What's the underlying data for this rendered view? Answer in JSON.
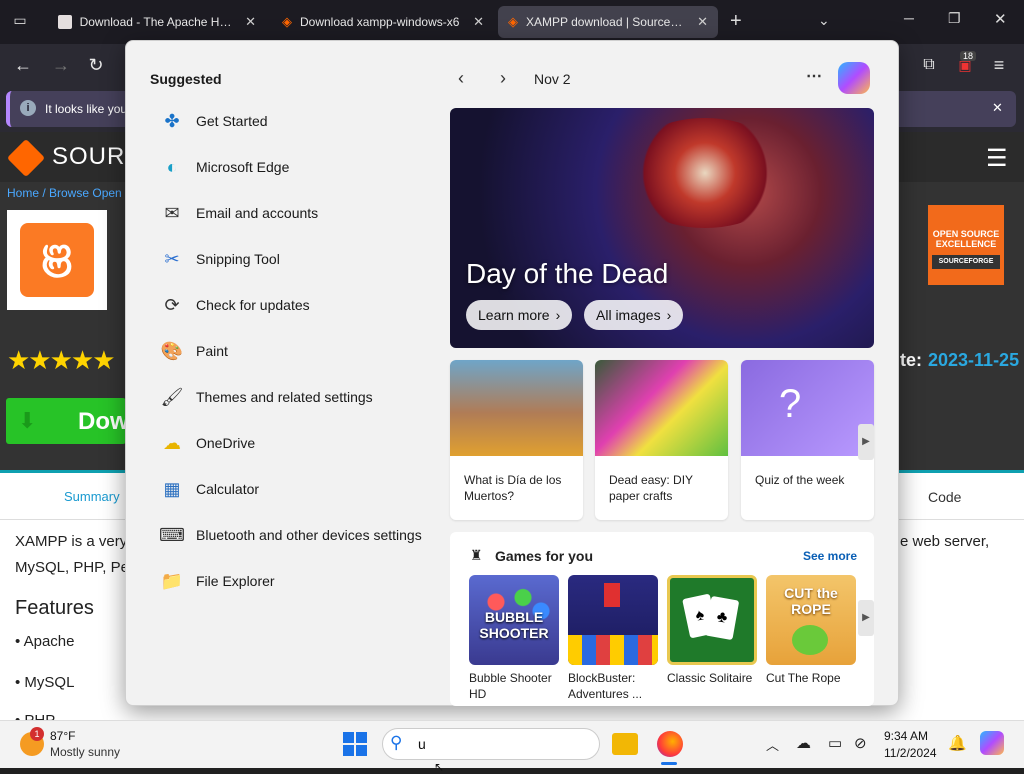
{
  "browser": {
    "tabs": [
      {
        "title": "Download - The Apache HTTP",
        "icon": "page-icon"
      },
      {
        "title": "Download xampp-windows-x6",
        "icon": "sourceforge-icon"
      },
      {
        "title": "XAMPP download | SourceForg",
        "icon": "sourceforge-icon",
        "active": true
      }
    ],
    "badge_count": "18",
    "notice_text": "It looks like you"
  },
  "page": {
    "brand": "SOURC",
    "breadcrumb": "Home / Browse Open S",
    "rating_stars": "★★★★★",
    "date_label": "te:",
    "date_value": "2023-11-25",
    "download_label": "Dow",
    "badge_line1": "OPEN SOURCE",
    "badge_line2": "EXCELLENCE",
    "badge_line3": "SOURCEFORGE",
    "tabs": {
      "summary": "Summary",
      "code": "Code"
    },
    "desc_left": "XAMPP is a very",
    "desc_left2": "MySQL, PHP, Pe",
    "desc_right": "e web server,",
    "features_title": "Features",
    "features": [
      "• Apache",
      "• MySQL",
      "• PHP"
    ]
  },
  "start_menu": {
    "suggested_title": "Suggested",
    "items": [
      {
        "label": "Get Started",
        "icon": "get-started-icon"
      },
      {
        "label": "Microsoft Edge",
        "icon": "edge-icon"
      },
      {
        "label": "Email and accounts",
        "icon": "mail-icon"
      },
      {
        "label": "Snipping Tool",
        "icon": "scissors-icon"
      },
      {
        "label": "Check for updates",
        "icon": "sync-icon"
      },
      {
        "label": "Paint",
        "icon": "paint-icon"
      },
      {
        "label": "Themes and related settings",
        "icon": "brush-icon"
      },
      {
        "label": "OneDrive",
        "icon": "cloud-icon"
      },
      {
        "label": "Calculator",
        "icon": "calculator-icon"
      },
      {
        "label": "Bluetooth and other devices settings",
        "icon": "devices-icon"
      },
      {
        "label": "File Explorer",
        "icon": "folder-icon"
      }
    ],
    "date": "Nov 2",
    "hero_title": "Day of the Dead",
    "learn_more": "Learn more",
    "all_images": "All images",
    "cards": [
      {
        "caption": "What is Día de los Muertos?"
      },
      {
        "caption": "Dead easy: DIY paper crafts"
      },
      {
        "caption": "Quiz of the week"
      }
    ],
    "games_title": "Games for you",
    "see_more": "See more",
    "games": [
      {
        "name": "Bubble Shooter HD",
        "art": "BUBBLE SHOOTER"
      },
      {
        "name": "BlockBuster: Adventures ...",
        "art": ""
      },
      {
        "name": "Classic Solitaire",
        "art": ""
      },
      {
        "name": "Cut The Rope",
        "art": "CUT the ROPE"
      }
    ]
  },
  "taskbar": {
    "weather_temp": "87°F",
    "weather_desc": "Mostly sunny",
    "weather_alert": "1",
    "search_value": "u",
    "time": "9:34 AM",
    "date": "11/2/2024"
  },
  "colors": {
    "accent": "#0a7ad4",
    "sourceforge": "#ff6600",
    "green": "#27c327",
    "teal": "#0fa0b0"
  }
}
